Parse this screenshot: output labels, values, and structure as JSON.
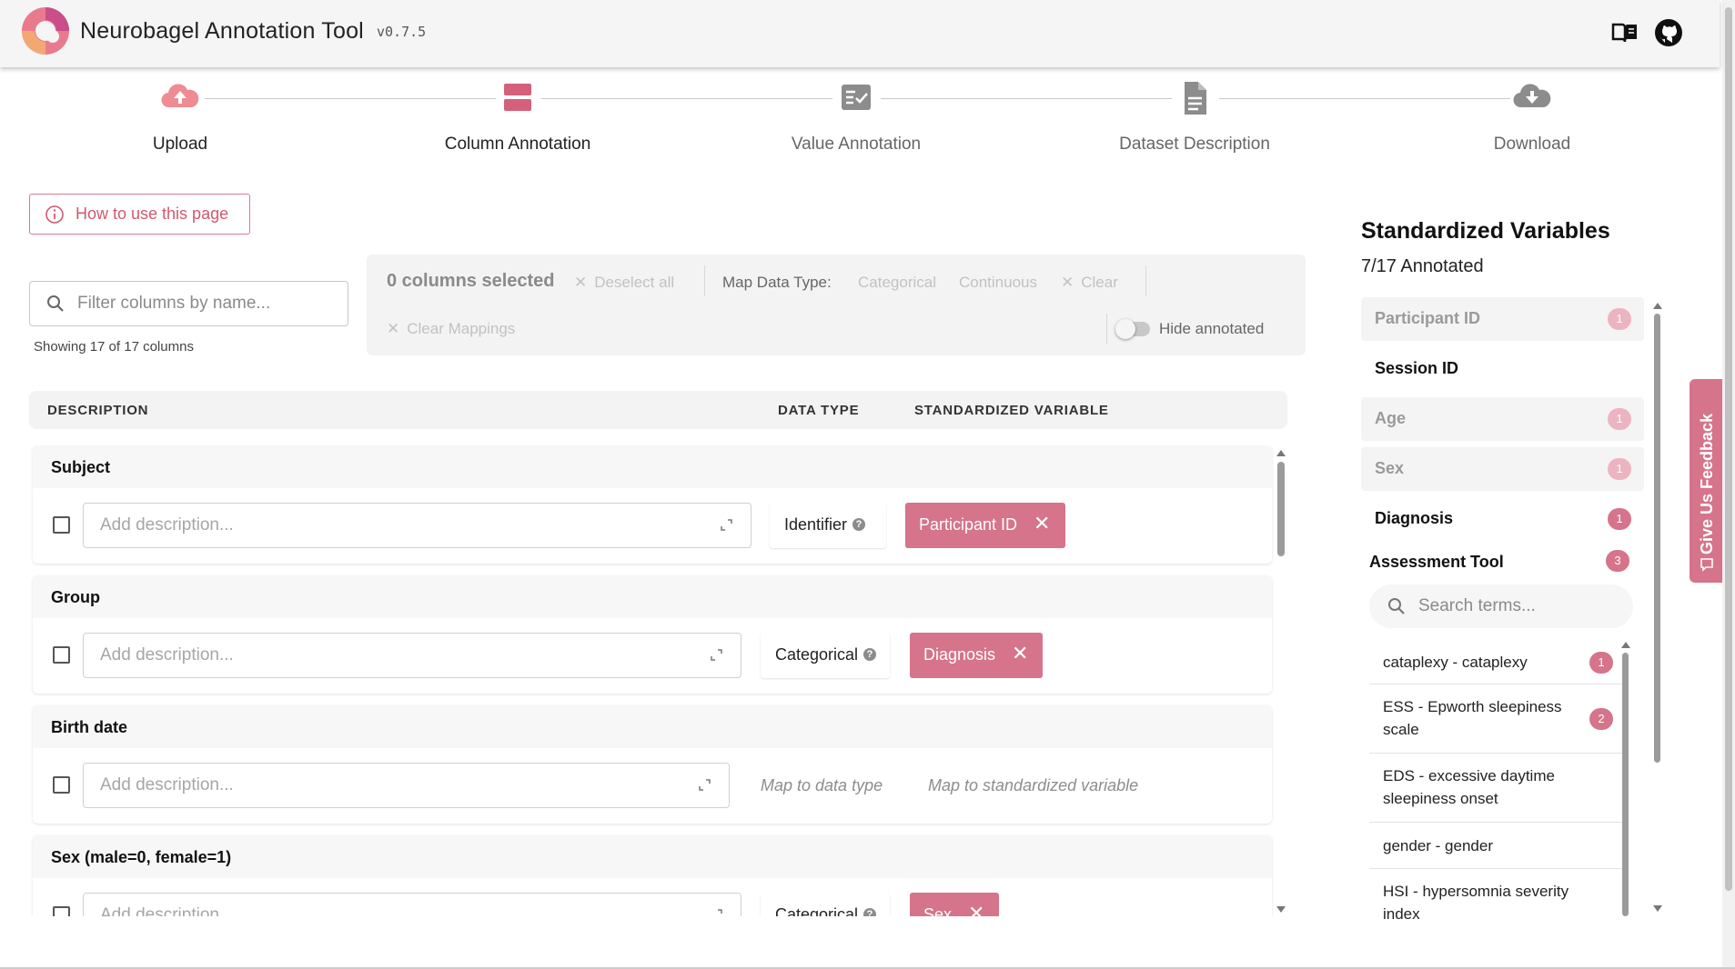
{
  "header": {
    "title": "Neurobagel Annotation Tool",
    "version": "v0.7.5",
    "icons": [
      "docs-book-icon",
      "github-icon"
    ]
  },
  "stepper": {
    "steps": [
      {
        "label": "Upload",
        "icon": "cloud-upload-icon",
        "state": "done"
      },
      {
        "label": "Column Annotation",
        "icon": "columns-icon",
        "state": "active"
      },
      {
        "label": "Value Annotation",
        "icon": "checklist-icon",
        "state": "pending"
      },
      {
        "label": "Dataset Description",
        "icon": "document-icon",
        "state": "pending"
      },
      {
        "label": "Download",
        "icon": "cloud-download-icon",
        "state": "pending"
      }
    ]
  },
  "help": {
    "label": "How to use this page"
  },
  "filter": {
    "placeholder": "Filter columns by name...",
    "showing": "Showing 17 of 17 columns"
  },
  "toolbar": {
    "selected": "0 columns selected",
    "deselect_all": "Deselect all",
    "map_data_type": "Map Data Type:",
    "categorical": "Categorical",
    "continuous": "Continuous",
    "clear": "Clear",
    "clear_mappings": "Clear Mappings",
    "hide_annotated": "Hide annotated"
  },
  "table": {
    "headers": {
      "description": "DESCRIPTION",
      "data_type": "DATA TYPE",
      "standardized_variable": "STANDARDIZED VARIABLE"
    },
    "description_placeholder": "Add description...",
    "rows": [
      {
        "name": "Subject",
        "data_type": "Identifier",
        "standardized_variable": "Participant ID"
      },
      {
        "name": "Group",
        "data_type": "Categorical",
        "standardized_variable": "Diagnosis"
      },
      {
        "name": "Birth date",
        "data_type": "Map to data type",
        "standardized_variable": "Map to standardized variable"
      },
      {
        "name": "Sex (male=0, female=1)",
        "data_type": "Categorical",
        "standardized_variable": "Sex"
      }
    ]
  },
  "panel": {
    "title": "Standardized Variables",
    "annotated": "7/17 Annotated",
    "variables": [
      {
        "label": "Participant ID",
        "count": "1",
        "state": "dim"
      },
      {
        "label": "Session ID",
        "count": "",
        "state": "on"
      },
      {
        "label": "Age",
        "count": "1",
        "state": "dim"
      },
      {
        "label": "Sex",
        "count": "1",
        "state": "dim"
      },
      {
        "label": "Diagnosis",
        "count": "1",
        "state": "on"
      }
    ],
    "assessment": {
      "label": "Assessment Tool",
      "count": "3"
    },
    "term_search_placeholder": "Search terms...",
    "terms": [
      {
        "label": "cataplexy - cataplexy",
        "count": "1"
      },
      {
        "label": "ESS - Epworth sleepiness scale",
        "count": "2"
      },
      {
        "label": "EDS - excessive daytime sleepiness onset",
        "count": ""
      },
      {
        "label": "gender - gender",
        "count": ""
      },
      {
        "label": "HSI - hypersomnia severity index",
        "count": ""
      }
    ]
  },
  "feedback": {
    "label": "Give Us Feedback"
  },
  "colors": {
    "accent": "#d5748a",
    "accent_faint": "#ecb4c0",
    "header_bg": "#f5f5f5"
  }
}
